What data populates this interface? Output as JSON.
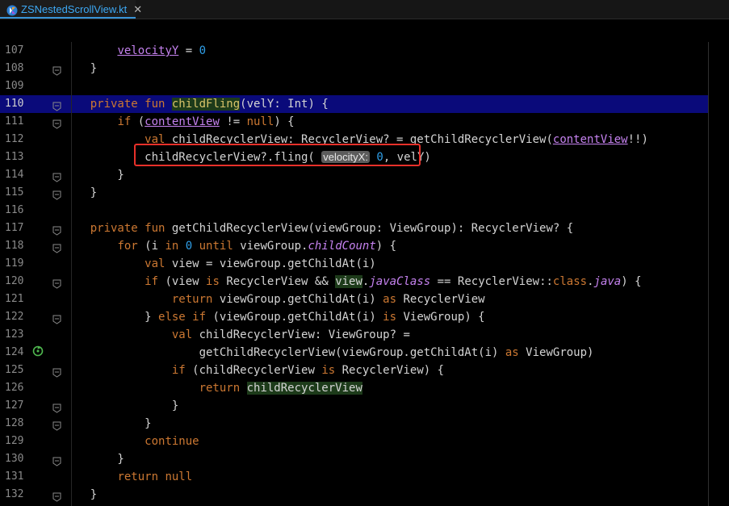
{
  "tab": {
    "file_name": "ZSNestedScrollView.kt",
    "close_glyph": "✕"
  },
  "colors": {
    "keyword": "#cc7832",
    "number": "#2f9fe8",
    "property": "#c582ef",
    "highlight_line": "#0a0a7a",
    "tab_text": "#3da9f5",
    "annotation_box": "#e8302a"
  },
  "lines": [
    {
      "n": "107",
      "code": [
        {
          "t": "        "
        },
        {
          "t": "velocityY",
          "c": "prop"
        },
        {
          "t": " = "
        },
        {
          "t": "0",
          "c": "num"
        }
      ]
    },
    {
      "n": "108",
      "code": [
        {
          "t": "    }"
        }
      ]
    },
    {
      "n": "109",
      "code": []
    },
    {
      "n": "110",
      "code": [
        {
          "t": "    "
        },
        {
          "t": "private fun ",
          "c": "kw"
        },
        {
          "t": "childFling",
          "c": "fn"
        },
        {
          "t": "(velY: Int) {"
        }
      ]
    },
    {
      "n": "111",
      "code": [
        {
          "t": "        "
        },
        {
          "t": "if ",
          "c": "kw"
        },
        {
          "t": "("
        },
        {
          "t": "contentView",
          "c": "prop"
        },
        {
          "t": " != "
        },
        {
          "t": "null",
          "c": "kw"
        },
        {
          "t": ") {"
        }
      ]
    },
    {
      "n": "112",
      "code": [
        {
          "t": "            "
        },
        {
          "t": "val ",
          "c": "kw"
        },
        {
          "t": "childRecyclerView: RecyclerView? = getChildRecyclerView("
        },
        {
          "t": "contentView",
          "c": "prop"
        },
        {
          "t": "!!)"
        }
      ]
    },
    {
      "n": "113",
      "code": [
        {
          "t": "            childRecyclerView?.fling( "
        },
        {
          "t": "velocityX:",
          "c": "hint"
        },
        {
          "t": " "
        },
        {
          "t": "0",
          "c": "num"
        },
        {
          "t": ", velY)"
        }
      ]
    },
    {
      "n": "114",
      "code": [
        {
          "t": "        }"
        }
      ]
    },
    {
      "n": "115",
      "code": [
        {
          "t": "    }"
        }
      ]
    },
    {
      "n": "116",
      "code": []
    },
    {
      "n": "117",
      "code": [
        {
          "t": "    "
        },
        {
          "t": "private fun ",
          "c": "kw"
        },
        {
          "t": "getChildRecyclerView(viewGroup: ViewGroup): RecyclerView? {"
        }
      ]
    },
    {
      "n": "118",
      "code": [
        {
          "t": "        "
        },
        {
          "t": "for ",
          "c": "kw"
        },
        {
          "t": "(i "
        },
        {
          "t": "in ",
          "c": "kw"
        },
        {
          "t": "0",
          "c": "num"
        },
        {
          "t": " "
        },
        {
          "t": "until ",
          "c": "kw"
        },
        {
          "t": "viewGroup."
        },
        {
          "t": "childCount",
          "c": "it"
        },
        {
          "t": ") {"
        }
      ]
    },
    {
      "n": "119",
      "code": [
        {
          "t": "            "
        },
        {
          "t": "val ",
          "c": "kw"
        },
        {
          "t": "view = viewGroup.getChildAt(i)"
        }
      ]
    },
    {
      "n": "120",
      "code": [
        {
          "t": "            "
        },
        {
          "t": "if ",
          "c": "kw"
        },
        {
          "t": "(view "
        },
        {
          "t": "is ",
          "c": "kw"
        },
        {
          "t": "RecyclerView && "
        },
        {
          "t": "view",
          "c": "hlv"
        },
        {
          "t": "."
        },
        {
          "t": "javaClass",
          "c": "it"
        },
        {
          "t": " == RecyclerView::"
        },
        {
          "t": "class",
          "c": "kw"
        },
        {
          "t": "."
        },
        {
          "t": "java",
          "c": "it"
        },
        {
          "t": ") {"
        }
      ]
    },
    {
      "n": "121",
      "code": [
        {
          "t": "                "
        },
        {
          "t": "return ",
          "c": "kw"
        },
        {
          "t": "viewGroup.getChildAt(i) "
        },
        {
          "t": "as ",
          "c": "kw"
        },
        {
          "t": "RecyclerView"
        }
      ]
    },
    {
      "n": "122",
      "code": [
        {
          "t": "            } "
        },
        {
          "t": "else if ",
          "c": "kw"
        },
        {
          "t": "(viewGroup.getChildAt(i) "
        },
        {
          "t": "is ",
          "c": "kw"
        },
        {
          "t": "ViewGroup) {"
        }
      ]
    },
    {
      "n": "123",
      "code": [
        {
          "t": "                "
        },
        {
          "t": "val ",
          "c": "kw"
        },
        {
          "t": "childRecyclerView: ViewGroup? ="
        }
      ]
    },
    {
      "n": "124",
      "code": [
        {
          "t": "                    getChildRecyclerView(viewGroup.getChildAt(i) "
        },
        {
          "t": "as ",
          "c": "kw"
        },
        {
          "t": "ViewGroup)"
        }
      ]
    },
    {
      "n": "125",
      "code": [
        {
          "t": "                "
        },
        {
          "t": "if ",
          "c": "kw"
        },
        {
          "t": "(childRecyclerView "
        },
        {
          "t": "is ",
          "c": "kw"
        },
        {
          "t": "RecyclerView) {"
        }
      ]
    },
    {
      "n": "126",
      "code": [
        {
          "t": "                    "
        },
        {
          "t": "return ",
          "c": "kw"
        },
        {
          "t": "childRecyclerView",
          "c": "hlv"
        }
      ]
    },
    {
      "n": "127",
      "code": [
        {
          "t": "                }"
        }
      ]
    },
    {
      "n": "128",
      "code": [
        {
          "t": "            }"
        }
      ]
    },
    {
      "n": "129",
      "code": [
        {
          "t": "            "
        },
        {
          "t": "continue",
          "c": "kw"
        }
      ]
    },
    {
      "n": "130",
      "code": [
        {
          "t": "        }"
        }
      ]
    },
    {
      "n": "131",
      "code": [
        {
          "t": "        "
        },
        {
          "t": "return null",
          "c": "kw"
        }
      ]
    },
    {
      "n": "132",
      "code": [
        {
          "t": "    }"
        }
      ]
    }
  ],
  "highlighted_line": "110",
  "fold_markers": [
    "108",
    "110",
    "111",
    "114",
    "115",
    "117",
    "118",
    "120",
    "122",
    "125",
    "127",
    "128",
    "130",
    "132"
  ],
  "recursion_gutter_line": "124"
}
